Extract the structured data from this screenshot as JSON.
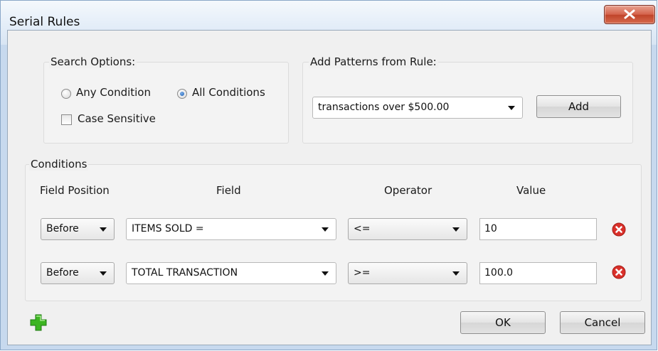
{
  "window": {
    "title": "Serial Rules"
  },
  "search_options": {
    "group_label": "Search Options:",
    "any_condition_label": "Any Condition",
    "all_conditions_label": "All Conditions",
    "case_sensitive_label": "Case Sensitive",
    "selected": "All Conditions",
    "case_sensitive_checked": false
  },
  "add_patterns": {
    "group_label": "Add Patterns from Rule:",
    "selected_rule": "transactions over $500.00",
    "add_label": "Add"
  },
  "conditions": {
    "group_label": "Conditions",
    "headers": {
      "field_position": "Field Position",
      "field": "Field",
      "operator": "Operator",
      "value": "Value"
    },
    "rows": [
      {
        "position": "Before",
        "field": "ITEMS SOLD =",
        "operator": "<=",
        "value": "10"
      },
      {
        "position": "Before",
        "field": "TOTAL TRANSACTION",
        "operator": ">=",
        "value": "100.0"
      }
    ]
  },
  "footer": {
    "ok_label": "OK",
    "cancel_label": "Cancel"
  },
  "colors": {
    "remove_icon": "#d9302a",
    "add_icon": "#3cb521",
    "close_button": "#c8452c"
  },
  "icons": {
    "close": "close-x-icon",
    "remove": "remove-circle-icon",
    "add": "plus-icon"
  }
}
